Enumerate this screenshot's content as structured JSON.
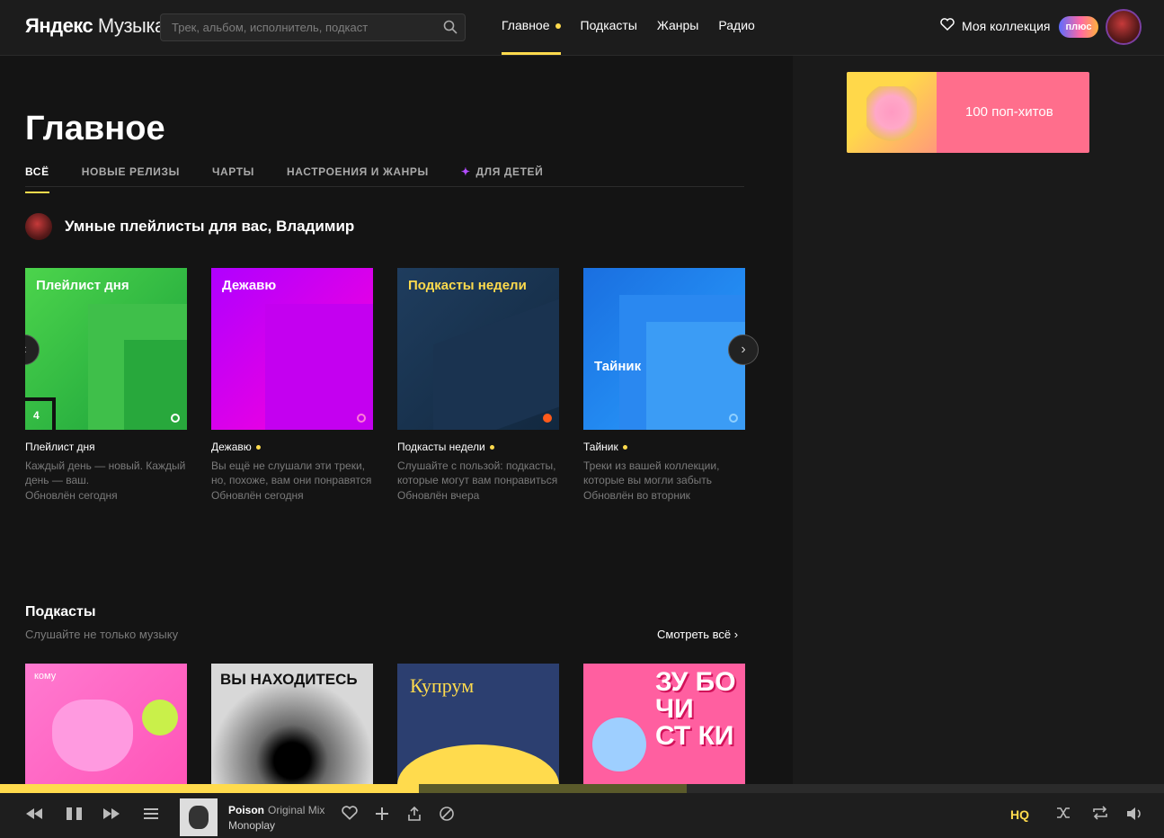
{
  "header": {
    "logo_bold": "Яндекс",
    "logo_regular": "Музыка",
    "search_placeholder": "Трек, альбом, исполнитель, подкаст",
    "nav": [
      "Главное",
      "Подкасты",
      "Жанры",
      "Радио"
    ],
    "collection": "Моя коллекция",
    "plus": "плюс"
  },
  "main": {
    "title": "Главное",
    "tabs": [
      "ВСЁ",
      "НОВЫЕ РЕЛИЗЫ",
      "ЧАРТЫ",
      "НАСТРОЕНИЯ И ЖАНРЫ",
      "ДЛЯ ДЕТЕЙ"
    ],
    "smart_title": "Умные плейлисты для вас, Владимир",
    "playlists": [
      {
        "cover_title": "Плейлист дня",
        "badge": "4",
        "name": "Плейлист дня",
        "desc": "Каждый день — новый. Каждый день — ваш.",
        "updated": "Обновлён сегодня"
      },
      {
        "cover_title": "Дежавю",
        "name": "Дежавю",
        "desc": "Вы ещё не слушали эти треки, но, похоже, вам они понравятся",
        "updated": "Обновлён сегодня"
      },
      {
        "cover_title": "Подкасты недели",
        "name": "Подкасты недели",
        "desc": "Слушайте с пользой: подкасты, которые могут вам понравиться",
        "updated": "Обновлён вчера"
      },
      {
        "cover_title": "Тайник",
        "name": "Тайник",
        "desc": "Треки из вашей коллекции, которые вы могли забыть",
        "updated": "Обновлён во вторник"
      }
    ],
    "podcasts_title": "Подкасты",
    "podcasts_subtitle": "Слушайте не только музыку",
    "see_all": "Смотреть всё",
    "podcast_covers": [
      "кому",
      "ВЫ НАХОДИТЕСЬ",
      "Купрум",
      "ЗУ БО ЧИ СТ КИ"
    ]
  },
  "sidebar": {
    "promo_text": "100 поп-хитов"
  },
  "player": {
    "title": "Poison",
    "version": "Original Mix",
    "artist": "Monoplay",
    "hq": "HQ",
    "progress_fraction": 0.36,
    "buffered_fraction": 0.59
  },
  "colors": {
    "accent": "#ffdb4d",
    "background": "#141414"
  }
}
